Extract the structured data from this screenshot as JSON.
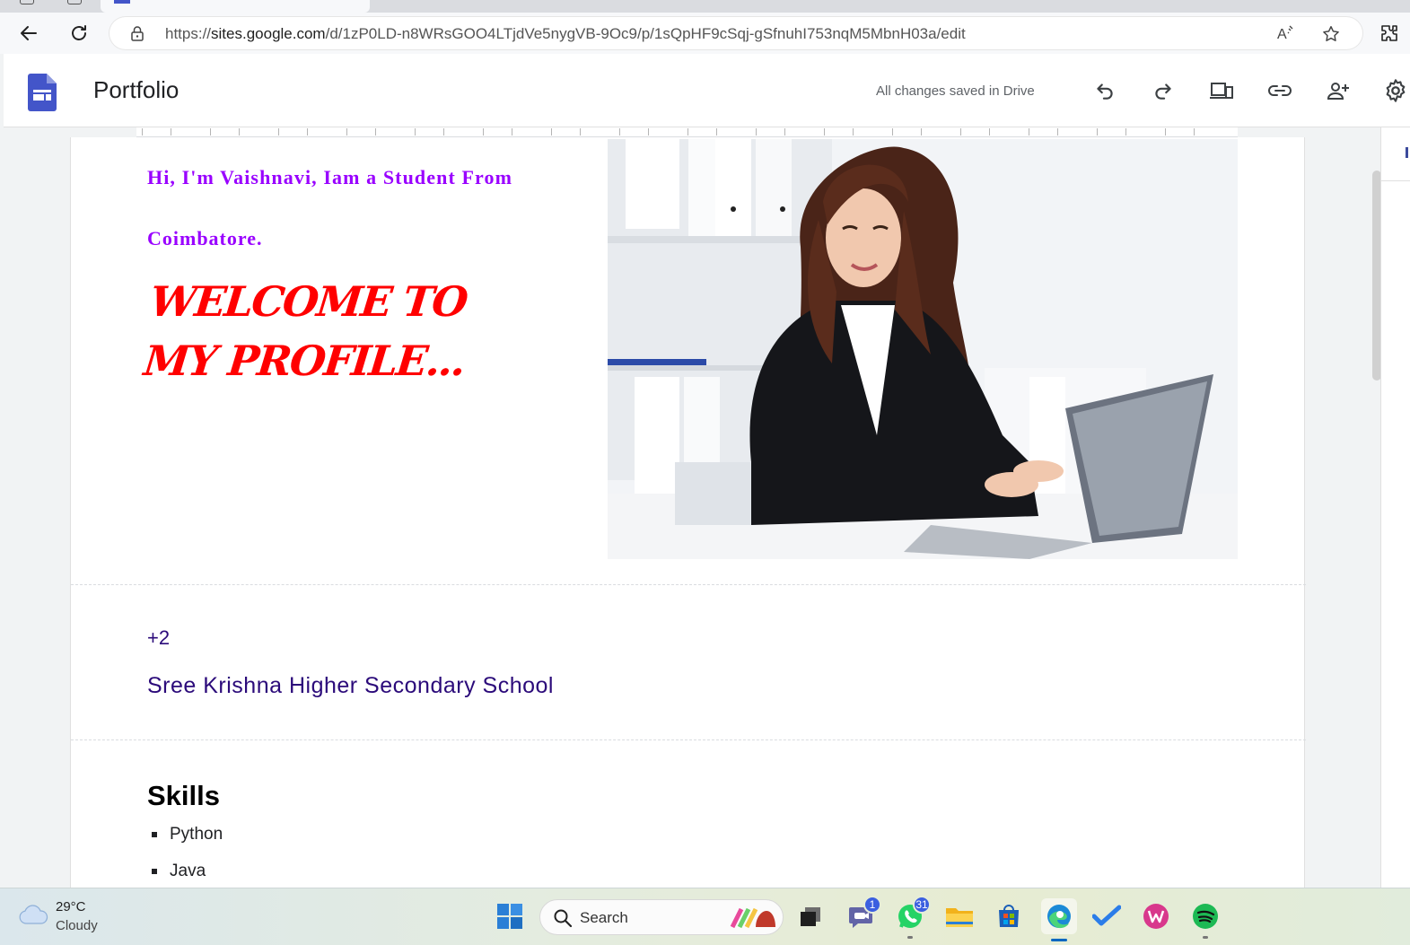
{
  "browser": {
    "url_prefix": "https://",
    "url_domain": "sites.google.com",
    "url_path": "/d/1zP0LD-n8WRsGOO4LTjdVe5nygVB-9Oc9/p/1sQpHF9cSqj-gSfnuhI753nqM5MbnH03a/edit",
    "icons": {
      "back": "back-arrow-icon",
      "reload": "reload-icon",
      "lock": "lock-icon",
      "read_aloud": "read-aloud-icon",
      "favorite": "star-icon",
      "extensions": "extensions-icon"
    }
  },
  "sites_header": {
    "title": "Portfolio",
    "status": "All changes saved in Drive",
    "brand_color": "#4355c9",
    "actions": [
      "undo-icon",
      "redo-icon",
      "preview-devices-icon",
      "link-icon",
      "share-person-icon",
      "settings-gear-icon"
    ]
  },
  "page": {
    "intro_line1": "Hi, I'm Vaishnavi, Iam a Student From",
    "intro_line2": "Coimbatore.",
    "welcome": "WELCOME TO MY PROFILE...",
    "intro_color": "#9900ff",
    "welcome_color": "#ff0000",
    "education_level": "+2",
    "school": "Sree Krishna Higher Secondary School",
    "education_color": "#2b0a7a",
    "skills_heading": "Skills",
    "skills": [
      "Python",
      "Java"
    ]
  },
  "taskbar": {
    "weather_temp": "29°C",
    "weather_cond": "Cloudy",
    "search_label": "Search",
    "apps": [
      {
        "name": "start-windows-icon"
      },
      {
        "name": "task-view-icon"
      },
      {
        "name": "teams-chat-icon",
        "badge": "1"
      },
      {
        "name": "whatsapp-icon",
        "badge": "31"
      },
      {
        "name": "file-explorer-icon"
      },
      {
        "name": "microsoft-store-icon"
      },
      {
        "name": "edge-browser-icon"
      },
      {
        "name": "todo-check-icon"
      },
      {
        "name": "wps-office-icon"
      },
      {
        "name": "spotify-icon"
      }
    ]
  }
}
